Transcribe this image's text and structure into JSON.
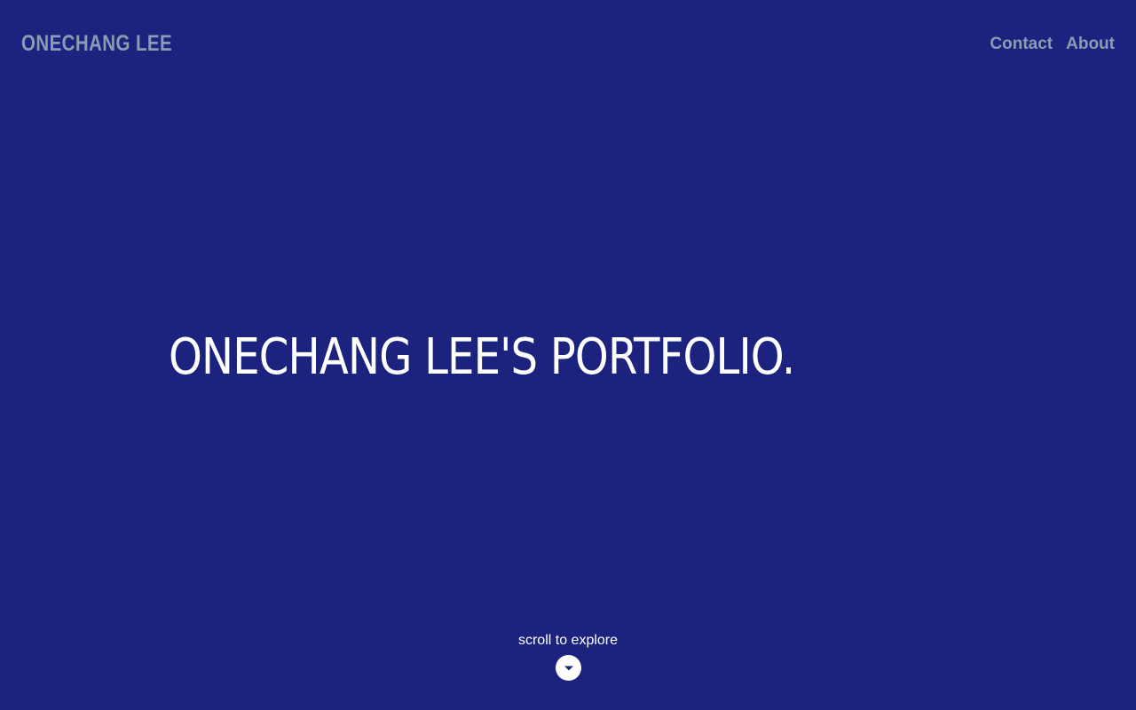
{
  "header": {
    "logo_text": "ONECHANG LEE",
    "nav": [
      {
        "label": "Contact"
      },
      {
        "label": "About"
      }
    ]
  },
  "hero": {
    "title": "ONECHANG LEE'S PORTFOLIO."
  },
  "scroll": {
    "label": "scroll to explore",
    "icon": "chevron-down-icon"
  },
  "colors": {
    "background": "#1b237f",
    "muted_text": "#8a9bb3",
    "text": "#ffffff"
  }
}
